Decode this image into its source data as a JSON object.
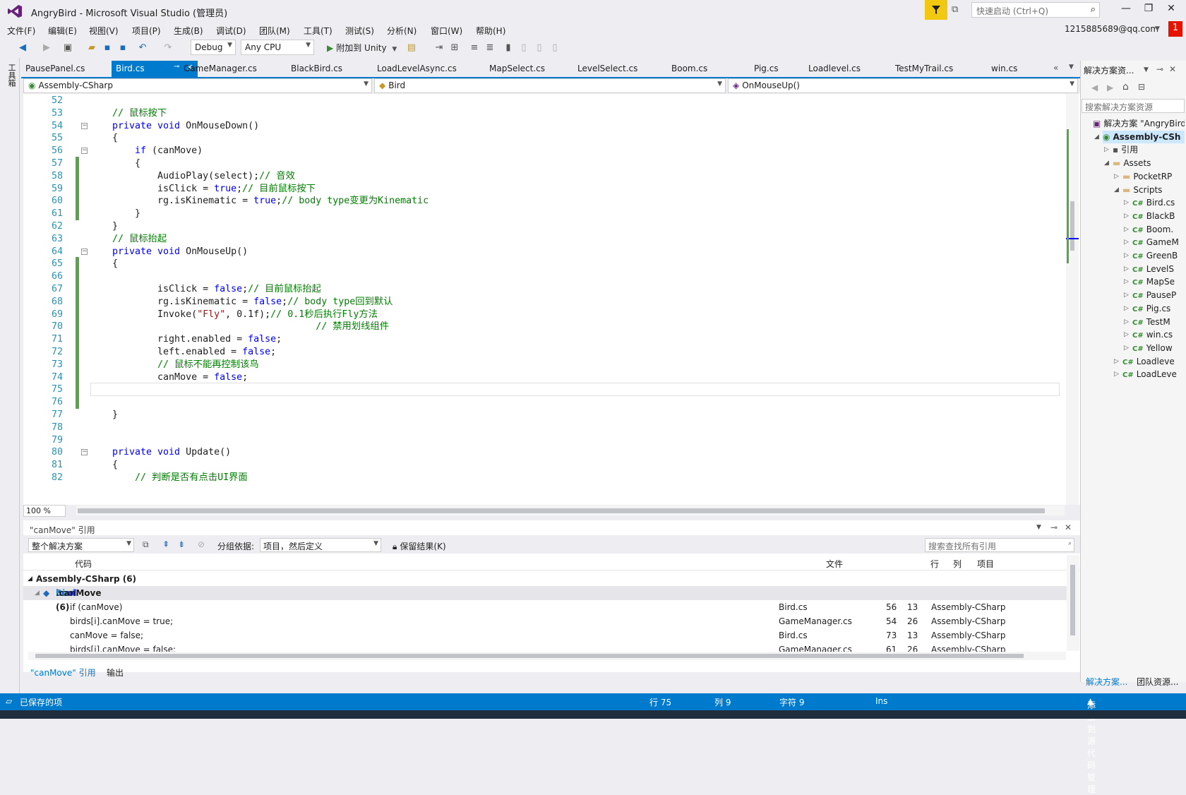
{
  "window": {
    "title": "AngryBird - Microsoft Visual Studio (管理员)",
    "quick_launch_placeholder": "快速启动 (Ctrl+Q)",
    "account": "1215885689@qq.com",
    "notification_count": "1",
    "accent": "#007acc"
  },
  "menu": [
    "文件(F)",
    "编辑(E)",
    "视图(V)",
    "项目(P)",
    "生成(B)",
    "调试(D)",
    "团队(M)",
    "工具(T)",
    "测试(S)",
    "分析(N)",
    "窗口(W)",
    "帮助(H)"
  ],
  "toolbar": {
    "config": "Debug",
    "platform": "Any CPU",
    "attach_label": "附加到 Unity"
  },
  "left_strip": {
    "toolbox": "工具箱"
  },
  "tabs": [
    "PausePanel.cs",
    "Bird.cs",
    "GameManager.cs",
    "BlackBird.cs",
    "LoadLevelAsync.cs",
    "MapSelect.cs",
    "LevelSelect.cs",
    "Boom.cs",
    "Pig.cs",
    "Loadlevel.cs",
    "TestMyTrail.cs",
    "win.cs"
  ],
  "active_tab": "Bird.cs",
  "nav": {
    "project": "Assembly-CSharp",
    "class": "Bird",
    "member": "OnMouseUp()"
  },
  "code_lines": [
    {
      "n": "52",
      "segs": []
    },
    {
      "n": "53",
      "segs": [
        {
          "t": "// 鼠标按下",
          "c": "cm"
        }
      ]
    },
    {
      "n": "54",
      "segs": [
        {
          "t": "private void ",
          "c": "kw"
        },
        {
          "t": "OnMouseDown()",
          "c": ""
        }
      ]
    },
    {
      "n": "55",
      "segs": [
        {
          "t": "{",
          "c": ""
        }
      ]
    },
    {
      "n": "56",
      "segs": [
        {
          "t": "    if ",
          "c": "kw"
        },
        {
          "t": "(canMove)",
          "c": ""
        }
      ]
    },
    {
      "n": "57",
      "segs": [
        {
          "t": "    {",
          "c": ""
        }
      ]
    },
    {
      "n": "58",
      "segs": [
        {
          "t": "        AudioPlay(select);",
          "c": ""
        },
        {
          "t": "// 音效",
          "c": "cm"
        }
      ]
    },
    {
      "n": "59",
      "segs": [
        {
          "t": "        isClick = ",
          "c": ""
        },
        {
          "t": "true",
          "c": "kw"
        },
        {
          "t": ";",
          "c": ""
        },
        {
          "t": "// 目前鼠标按下",
          "c": "cm"
        }
      ]
    },
    {
      "n": "60",
      "segs": [
        {
          "t": "        rg.isKinematic = ",
          "c": ""
        },
        {
          "t": "true",
          "c": "kw"
        },
        {
          "t": ";",
          "c": ""
        },
        {
          "t": "// body type变更为Kinematic",
          "c": "cm"
        }
      ]
    },
    {
      "n": "61",
      "segs": [
        {
          "t": "    }",
          "c": ""
        }
      ]
    },
    {
      "n": "62",
      "segs": [
        {
          "t": "}",
          "c": ""
        }
      ]
    },
    {
      "n": "63",
      "segs": [
        {
          "t": "// 鼠标抬起",
          "c": "cm"
        }
      ]
    },
    {
      "n": "64",
      "segs": [
        {
          "t": "private void ",
          "c": "kw"
        },
        {
          "t": "OnMouseUp()",
          "c": ""
        }
      ]
    },
    {
      "n": "65",
      "segs": [
        {
          "t": "{",
          "c": ""
        }
      ]
    },
    {
      "n": "66",
      "segs": []
    },
    {
      "n": "67",
      "segs": [
        {
          "t": "        isClick = ",
          "c": ""
        },
        {
          "t": "false",
          "c": "kw"
        },
        {
          "t": ";",
          "c": ""
        },
        {
          "t": "// 目前鼠标抬起",
          "c": "cm"
        }
      ]
    },
    {
      "n": "68",
      "segs": [
        {
          "t": "        rg.isKinematic = ",
          "c": ""
        },
        {
          "t": "false",
          "c": "kw"
        },
        {
          "t": ";",
          "c": ""
        },
        {
          "t": "// body type回到默认",
          "c": "cm"
        }
      ]
    },
    {
      "n": "69",
      "segs": [
        {
          "t": "        Invoke(",
          "c": ""
        },
        {
          "t": "\"Fly\"",
          "c": "st"
        },
        {
          "t": ", 0.1f);",
          "c": ""
        },
        {
          "t": "// 0.1秒后执行Fly方法",
          "c": "cm"
        }
      ]
    },
    {
      "n": "70",
      "segs": [
        {
          "t": "                                    // 禁用划线组件",
          "c": "cm"
        }
      ]
    },
    {
      "n": "71",
      "segs": [
        {
          "t": "        right.enabled = ",
          "c": ""
        },
        {
          "t": "false",
          "c": "kw"
        },
        {
          "t": ";",
          "c": ""
        }
      ]
    },
    {
      "n": "72",
      "segs": [
        {
          "t": "        left.enabled = ",
          "c": ""
        },
        {
          "t": "false",
          "c": "kw"
        },
        {
          "t": ";",
          "c": ""
        }
      ]
    },
    {
      "n": "73",
      "segs": [
        {
          "t": "        // 鼠标不能再控制该鸟",
          "c": "cm"
        }
      ]
    },
    {
      "n": "74",
      "segs": [
        {
          "t": "        canMove = ",
          "c": ""
        },
        {
          "t": "false",
          "c": "kw"
        },
        {
          "t": ";",
          "c": ""
        }
      ]
    },
    {
      "n": "75",
      "segs": []
    },
    {
      "n": "76",
      "segs": []
    },
    {
      "n": "77",
      "segs": [
        {
          "t": "}",
          "c": ""
        }
      ]
    },
    {
      "n": "78",
      "segs": []
    },
    {
      "n": "79",
      "segs": []
    },
    {
      "n": "80",
      "segs": [
        {
          "t": "private void ",
          "c": "kw"
        },
        {
          "t": "Update()",
          "c": ""
        }
      ]
    },
    {
      "n": "81",
      "segs": [
        {
          "t": "{",
          "c": ""
        }
      ]
    },
    {
      "n": "82",
      "segs": [
        {
          "t": "    // 判断是否有点击UI界面",
          "c": "cm"
        }
      ]
    }
  ],
  "changed_lines": [
    "57",
    "58",
    "59",
    "60",
    "61",
    "65",
    "66",
    "67",
    "68",
    "69",
    "70",
    "71",
    "72",
    "73",
    "74",
    "75",
    "76"
  ],
  "fold_lines": [
    "54",
    "56",
    "64",
    "80"
  ],
  "zoom": "100 %",
  "refs": {
    "title": "\"canMove\" 引用",
    "scope": "整个解决方案",
    "group_by_label": "分组依据:",
    "group_by_value": "项目，然后定义",
    "keep_results": "保留结果(K)",
    "search_placeholder": "搜索查找所有引用",
    "columns": [
      "代码",
      "文件",
      "行",
      "列",
      "项目"
    ],
    "group": "Assembly-CSharp (6)",
    "def_kw": "bool",
    "def_class": "Bird",
    "def_rest": ".canMove  (6)",
    "rows": [
      {
        "code": "if (canMove)",
        "file": "Bird.cs",
        "line": "56",
        "col": "13",
        "project": "Assembly-CSharp"
      },
      {
        "code": "birds[i].canMove = true;",
        "file": "GameManager.cs",
        "line": "54",
        "col": "26",
        "project": "Assembly-CSharp"
      },
      {
        "code": "canMove = false;",
        "file": "Bird.cs",
        "line": "73",
        "col": "13",
        "project": "Assembly-CSharp"
      },
      {
        "code": "birds[i].canMove = false;",
        "file": "GameManager.cs",
        "line": "61",
        "col": "26",
        "project": "Assembly-CSharp"
      }
    ]
  },
  "bottom_tabs": [
    "\"canMove\" 引用",
    "输出"
  ],
  "solution": {
    "title": "解决方案资...",
    "search_placeholder": "搜索解决方案资源",
    "tree": [
      {
        "label": "解决方案 \"AngryBird\"",
        "indent": 0,
        "exp": ""
      },
      {
        "label": "Assembly-CSh",
        "indent": 1,
        "exp": "open",
        "bold": true
      },
      {
        "label": "引用",
        "indent": 2,
        "exp": "closed"
      },
      {
        "label": "Assets",
        "indent": 2,
        "exp": "open"
      },
      {
        "label": "PocketRP",
        "indent": 3,
        "exp": "closed"
      },
      {
        "label": "Scripts",
        "indent": 3,
        "exp": "open"
      },
      {
        "label": "Bird.cs",
        "indent": 4,
        "exp": "closed",
        "cs": true
      },
      {
        "label": "BlackB",
        "indent": 4,
        "exp": "closed",
        "cs": true
      },
      {
        "label": "Boom.",
        "indent": 4,
        "exp": "closed",
        "cs": true
      },
      {
        "label": "GameM",
        "indent": 4,
        "exp": "closed",
        "cs": true
      },
      {
        "label": "GreenB",
        "indent": 4,
        "exp": "closed",
        "cs": true
      },
      {
        "label": "LevelS",
        "indent": 4,
        "exp": "closed",
        "cs": true
      },
      {
        "label": "MapSe",
        "indent": 4,
        "exp": "closed",
        "cs": true
      },
      {
        "label": "PauseP",
        "indent": 4,
        "exp": "closed",
        "cs": true
      },
      {
        "label": "Pig.cs",
        "indent": 4,
        "exp": "closed",
        "cs": true
      },
      {
        "label": "TestM",
        "indent": 4,
        "exp": "closed",
        "cs": true
      },
      {
        "label": "win.cs",
        "indent": 4,
        "exp": "closed",
        "cs": true
      },
      {
        "label": "Yellow",
        "indent": 4,
        "exp": "closed",
        "cs": true
      },
      {
        "label": "Loadleve",
        "indent": 3,
        "exp": "closed",
        "cs": true
      },
      {
        "label": "LoadLeve",
        "indent": 3,
        "exp": "closed",
        "cs": true
      }
    ],
    "bottom_tabs": [
      "解决方案...",
      "团队资源..."
    ]
  },
  "status": {
    "left": "已保存的项",
    "row": "行 75",
    "col": "列 9",
    "char": "字符 9",
    "mode": "Ins",
    "source_control": "添加到源代码管理"
  }
}
